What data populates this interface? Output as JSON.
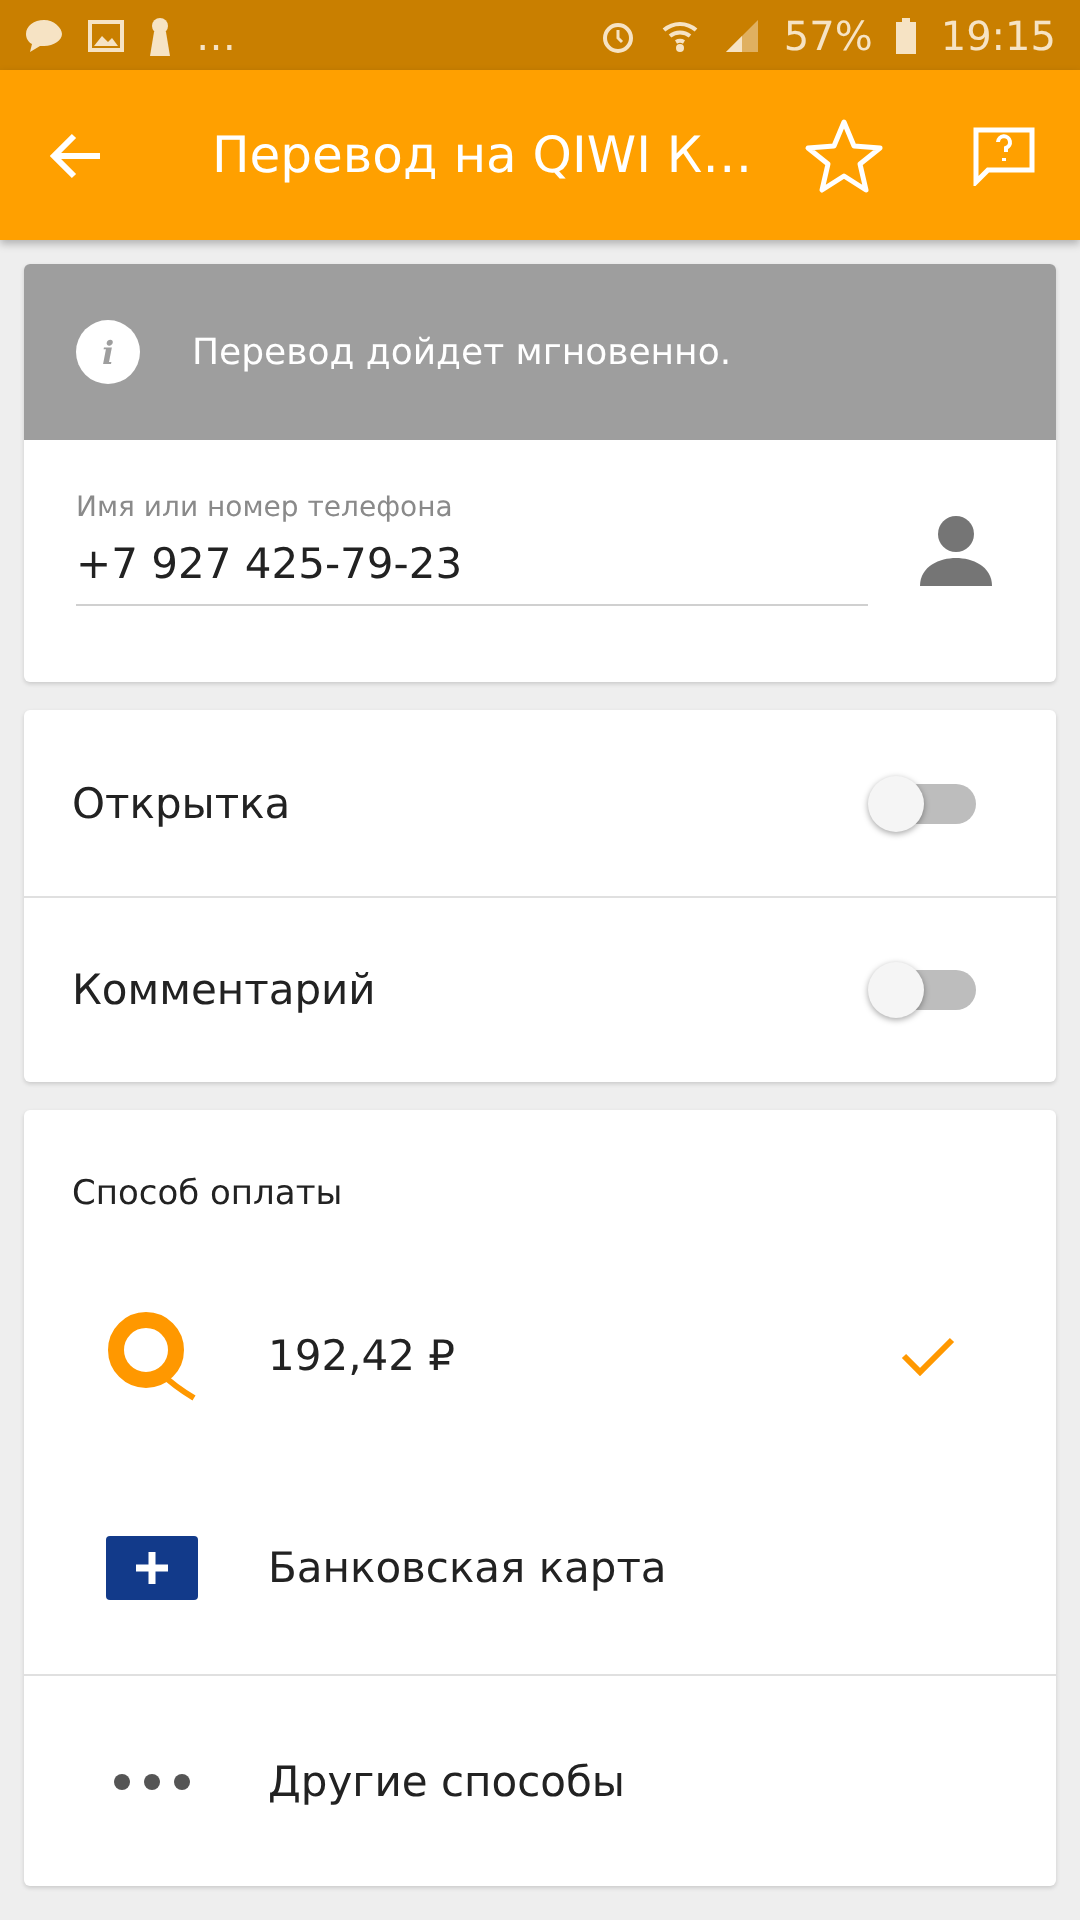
{
  "status_bar": {
    "overflow": "…",
    "battery": "57%",
    "time": "19:15"
  },
  "toolbar": {
    "title": "Перевод на QIWI К…"
  },
  "notice": {
    "text": "Перевод дойдет мгновенно.",
    "icon": "i"
  },
  "recipient": {
    "label": "Имя или номер телефона",
    "value": "+7 927 425-79-23"
  },
  "options": [
    {
      "label": "Открытка",
      "on": false
    },
    {
      "label": "Комментарий",
      "on": false
    }
  ],
  "payment": {
    "title": "Способ оплаты",
    "methods": [
      {
        "kind": "qiwi",
        "label": "192,42 ₽",
        "selected": true
      },
      {
        "kind": "card",
        "label": "Банковская карта",
        "selected": false
      },
      {
        "kind": "more",
        "label": "Другие способы",
        "selected": false
      }
    ]
  }
}
